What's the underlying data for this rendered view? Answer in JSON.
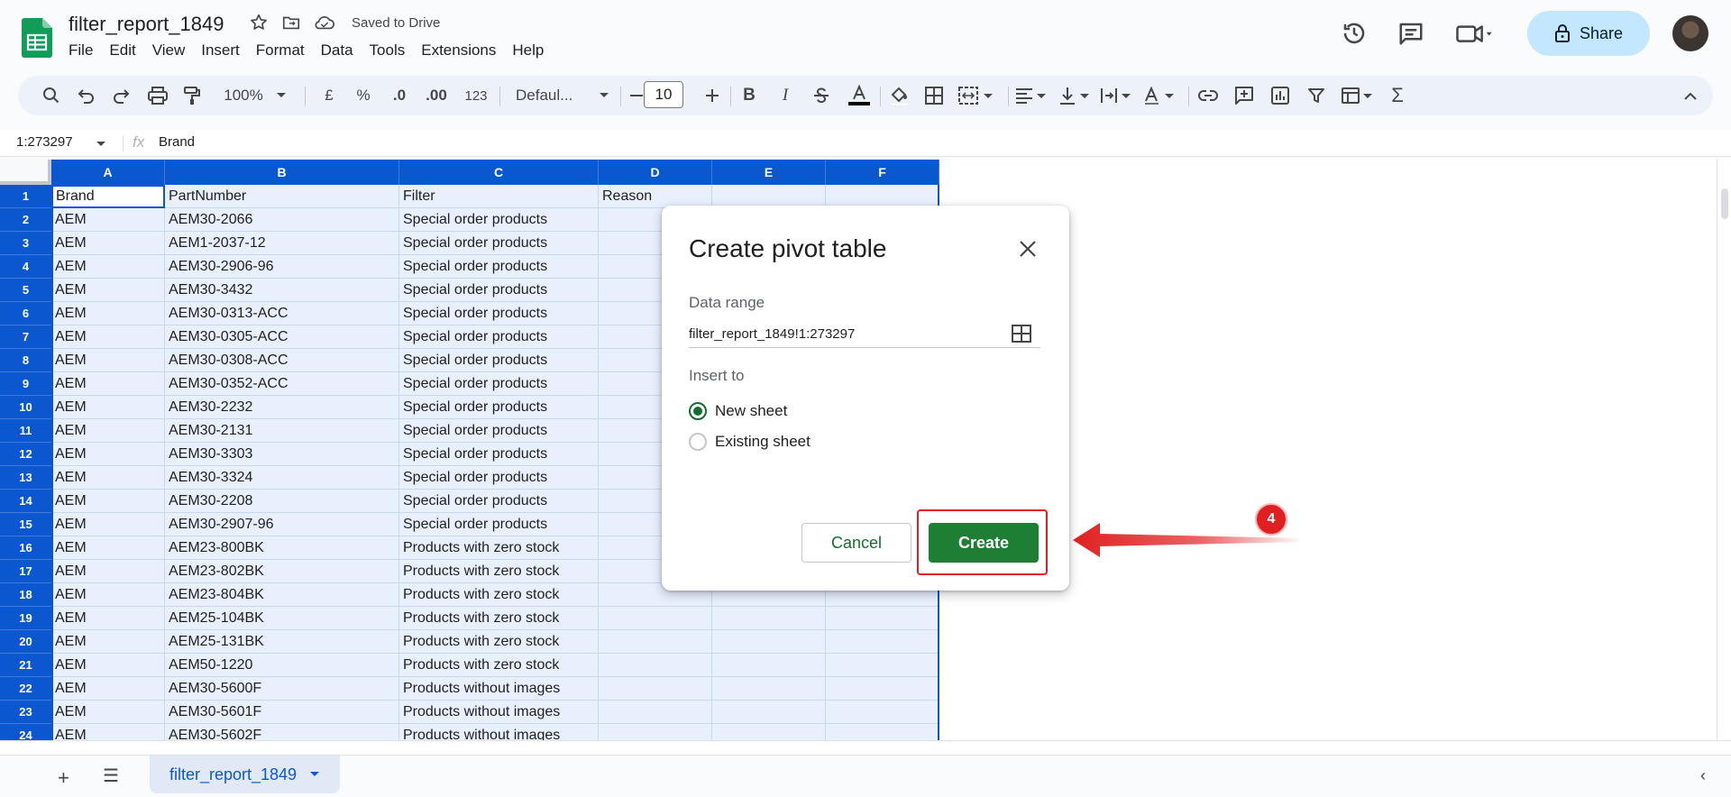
{
  "app": {
    "doc_title": "filter_report_1849",
    "saved_status": "Saved to Drive",
    "menu": [
      "File",
      "Edit",
      "View",
      "Insert",
      "Format",
      "Data",
      "Tools",
      "Extensions",
      "Help"
    ],
    "share_label": "Share"
  },
  "toolbar": {
    "zoom": "100%",
    "currency": "£",
    "percent": "%",
    "dec_decrease": ".0",
    "dec_increase": ".00",
    "number_format": "123",
    "font": "Defaul...",
    "font_size": "10"
  },
  "formula": {
    "name_box": "1:273297",
    "fx": "fx",
    "value": "Brand"
  },
  "columns": [
    "A",
    "B",
    "C",
    "D",
    "E",
    "F"
  ],
  "rows": [
    {
      "n": "1",
      "a": "Brand",
      "b": "PartNumber",
      "c": "Filter",
      "d": "Reason"
    },
    {
      "n": "2",
      "a": "AEM",
      "b": "AEM30-2066",
      "c": "Special order products",
      "d": ""
    },
    {
      "n": "3",
      "a": "AEM",
      "b": "AEM1-2037-12",
      "c": "Special order products",
      "d": ""
    },
    {
      "n": "4",
      "a": "AEM",
      "b": "AEM30-2906-96",
      "c": "Special order products",
      "d": ""
    },
    {
      "n": "5",
      "a": "AEM",
      "b": "AEM30-3432",
      "c": "Special order products",
      "d": ""
    },
    {
      "n": "6",
      "a": "AEM",
      "b": "AEM30-0313-ACC",
      "c": "Special order products",
      "d": ""
    },
    {
      "n": "7",
      "a": "AEM",
      "b": "AEM30-0305-ACC",
      "c": "Special order products",
      "d": ""
    },
    {
      "n": "8",
      "a": "AEM",
      "b": "AEM30-0308-ACC",
      "c": "Special order products",
      "d": ""
    },
    {
      "n": "9",
      "a": "AEM",
      "b": "AEM30-0352-ACC",
      "c": "Special order products",
      "d": ""
    },
    {
      "n": "10",
      "a": "AEM",
      "b": "AEM30-2232",
      "c": "Special order products",
      "d": ""
    },
    {
      "n": "11",
      "a": "AEM",
      "b": "AEM30-2131",
      "c": "Special order products",
      "d": ""
    },
    {
      "n": "12",
      "a": "AEM",
      "b": "AEM30-3303",
      "c": "Special order products",
      "d": ""
    },
    {
      "n": "13",
      "a": "AEM",
      "b": "AEM30-3324",
      "c": "Special order products",
      "d": ""
    },
    {
      "n": "14",
      "a": "AEM",
      "b": "AEM30-2208",
      "c": "Special order products",
      "d": ""
    },
    {
      "n": "15",
      "a": "AEM",
      "b": "AEM30-2907-96",
      "c": "Special order products",
      "d": ""
    },
    {
      "n": "16",
      "a": "AEM",
      "b": "AEM23-800BK",
      "c": "Products with zero stock",
      "d": ""
    },
    {
      "n": "17",
      "a": "AEM",
      "b": "AEM23-802BK",
      "c": "Products with zero stock",
      "d": ""
    },
    {
      "n": "18",
      "a": "AEM",
      "b": "AEM23-804BK",
      "c": "Products with zero stock",
      "d": ""
    },
    {
      "n": "19",
      "a": "AEM",
      "b": "AEM25-104BK",
      "c": "Products with zero stock",
      "d": ""
    },
    {
      "n": "20",
      "a": "AEM",
      "b": "AEM25-131BK",
      "c": "Products with zero stock",
      "d": ""
    },
    {
      "n": "21",
      "a": "AEM",
      "b": "AEM50-1220",
      "c": "Products with zero stock",
      "d": ""
    },
    {
      "n": "22",
      "a": "AEM",
      "b": "AEM30-5600F",
      "c": "Products without images",
      "d": ""
    },
    {
      "n": "23",
      "a": "AEM",
      "b": "AEM30-5601F",
      "c": "Products without images",
      "d": ""
    },
    {
      "n": "24",
      "a": "AEM",
      "b": "AEM30-5602F",
      "c": "Products without images",
      "d": ""
    }
  ],
  "sheet_tab": "filter_report_1849",
  "dialog": {
    "title": "Create pivot table",
    "data_range_label": "Data range",
    "data_range_value": "filter_report_1849!1:273297",
    "insert_to_label": "Insert to",
    "option_new": "New sheet",
    "option_existing": "Existing sheet",
    "selected_option": "New sheet",
    "cancel_label": "Cancel",
    "create_label": "Create"
  },
  "annotation": {
    "step_number": "4",
    "color": "#e02020"
  },
  "colors": {
    "accent": "#0b57d0",
    "create_button": "#1e7e34",
    "share_bg": "#c2e7ff"
  }
}
